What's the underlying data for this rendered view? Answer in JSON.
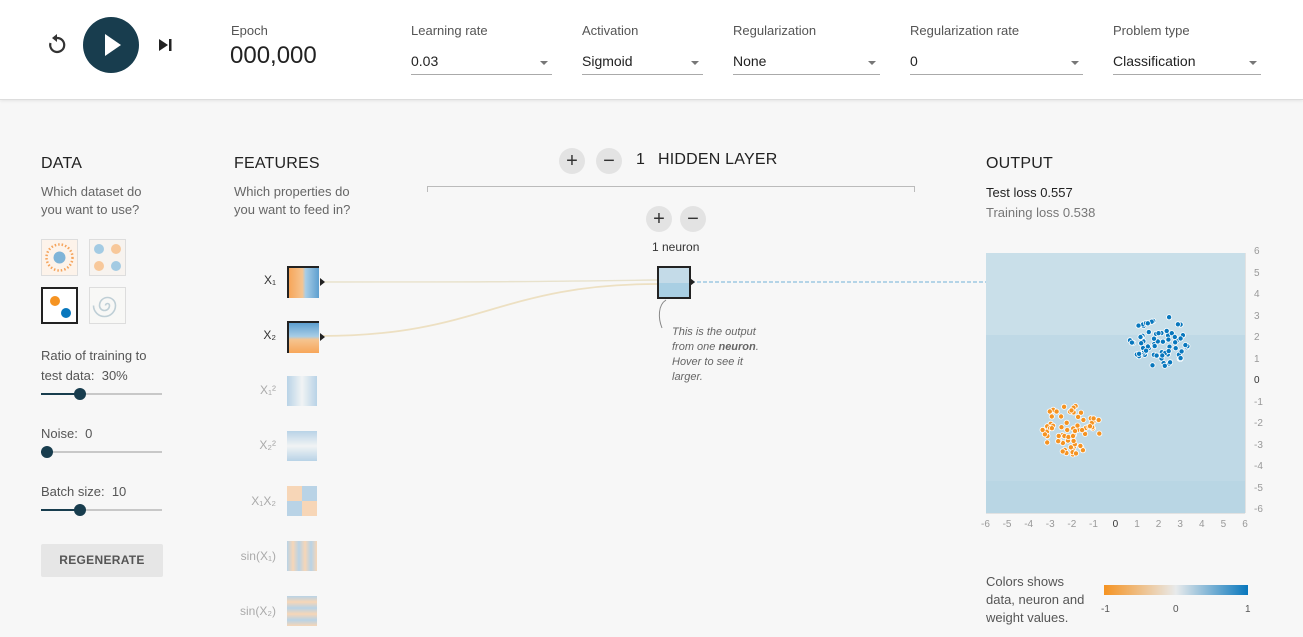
{
  "topbar": {
    "epoch_label": "Epoch",
    "epoch_value": "000,000",
    "controls": [
      {
        "label": "Learning rate",
        "value": "0.03"
      },
      {
        "label": "Activation",
        "value": "Sigmoid"
      },
      {
        "label": "Regularization",
        "value": "None"
      },
      {
        "label": "Regularization rate",
        "value": "0"
      },
      {
        "label": "Problem type",
        "value": "Classification"
      }
    ]
  },
  "data": {
    "heading": "DATA",
    "question": "Which dataset do you want to use?",
    "datasets": [
      "circle-dataset",
      "xor-dataset",
      "gaussian-dataset",
      "spiral-dataset"
    ],
    "selected_dataset": "gaussian-dataset",
    "ratio_label": "Ratio of training to test data:",
    "ratio_value": "30%",
    "ratio_fraction": 0.3,
    "noise_label": "Noise:",
    "noise_value": "0",
    "noise_fraction": 0.0,
    "batch_label": "Batch size:",
    "batch_value": "10",
    "batch_fraction": 0.3,
    "regenerate": "REGENERATE"
  },
  "features": {
    "heading": "FEATURES",
    "question": "Which properties do you want to feed in?",
    "items": [
      {
        "label": "X₁",
        "active": true
      },
      {
        "label": "X₂",
        "active": true
      },
      {
        "label": "X₁²",
        "active": false
      },
      {
        "label": "X₂²",
        "active": false
      },
      {
        "label": "X₁X₂",
        "active": false
      },
      {
        "label": "sin(X₁)",
        "active": false
      },
      {
        "label": "sin(X₂)",
        "active": false
      }
    ]
  },
  "network": {
    "layer_count": "1",
    "layer_label": "HIDDEN LAYER",
    "add_layer": "+",
    "remove_layer": "−",
    "add_neuron": "+",
    "remove_neuron": "−",
    "neuron_count": "1 neuron",
    "tip_line1": "This is the output",
    "tip_line2_pre": "from one ",
    "tip_bold": "neuron",
    "tip_line2_post": ".",
    "tip_line3": "Hover to see it",
    "tip_line4": "larger."
  },
  "output": {
    "heading": "OUTPUT",
    "test_loss_label": "Test loss",
    "test_loss_value": "0.557",
    "training_loss_label": "Training loss",
    "training_loss_value": "0.538",
    "y_ticks": [
      "6",
      "5",
      "4",
      "3",
      "2",
      "1",
      "0",
      "-1",
      "-2",
      "-3",
      "-4",
      "-5",
      "-6"
    ],
    "x_ticks": [
      "-6",
      "-5",
      "-4",
      "-3",
      "-2",
      "-1",
      "0",
      "1",
      "2",
      "3",
      "4",
      "5",
      "6"
    ],
    "legend_line1": "Colors shows",
    "legend_line2": "data, neuron and",
    "legend_line3": "weight values.",
    "legend_min": "-1",
    "legend_mid": "0",
    "legend_max": "1"
  },
  "colors": {
    "accent": "#183d4e",
    "positive": "#0877bd",
    "negative": "#f59322"
  }
}
